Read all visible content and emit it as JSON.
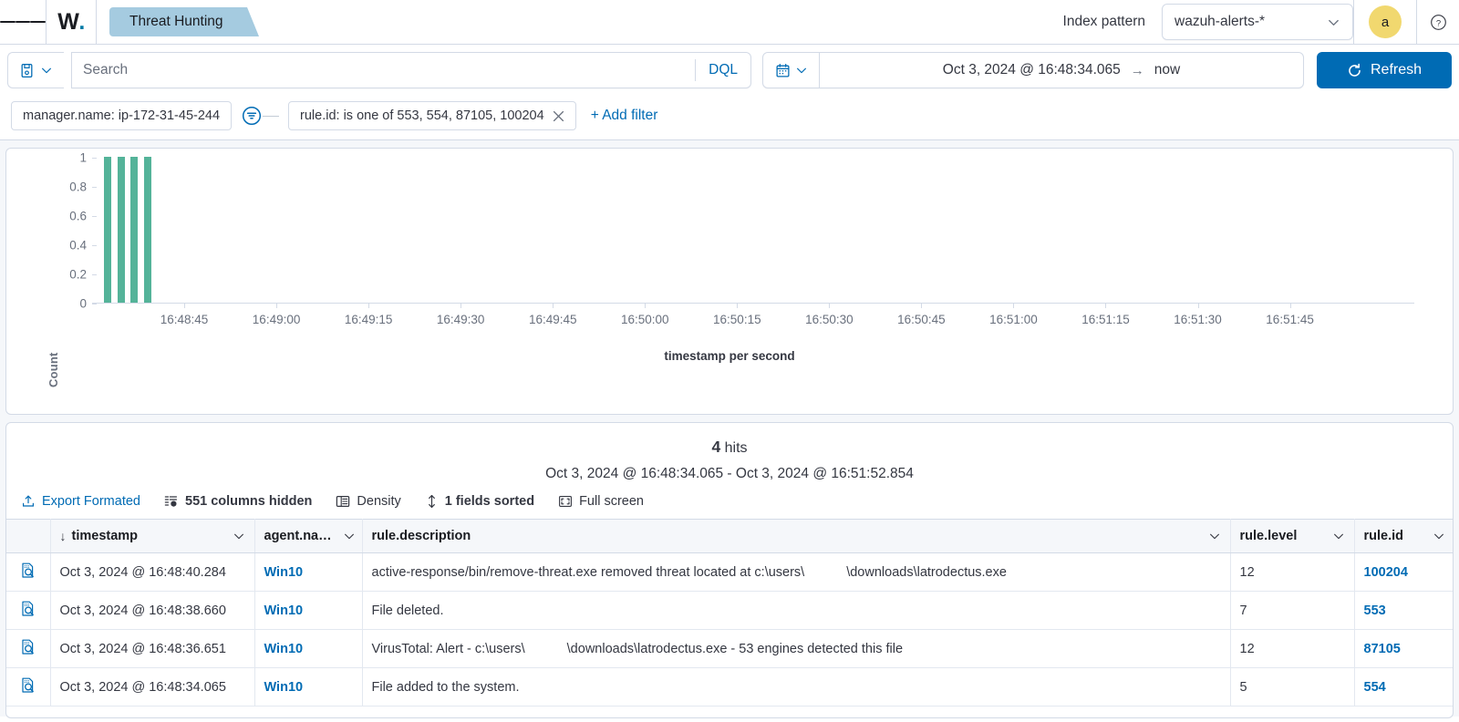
{
  "header": {
    "logo_text": "W",
    "app_tab": "Threat Hunting",
    "index_pattern_label": "Index pattern",
    "index_pattern_value": "wazuh-alerts-*",
    "avatar_initial": "a"
  },
  "query": {
    "search_placeholder": "Search",
    "search_value": "",
    "language": "DQL",
    "date_from": "Oct 3, 2024 @ 16:48:34.065",
    "date_arrow": "→",
    "date_to": "now",
    "refresh_label": "Refresh"
  },
  "filters": {
    "pill1": "manager.name: ip-172-31-45-244",
    "pill2": "rule.id: is one of 553, 554, 87105, 100204",
    "add_filter": "+ Add filter"
  },
  "chart_data": {
    "type": "bar",
    "title": "",
    "xlabel": "timestamp per second",
    "ylabel": "Count",
    "ylim": [
      0,
      1
    ],
    "yticks": [
      "0",
      "0.2",
      "0.4",
      "0.6",
      "0.8",
      "1"
    ],
    "ytick_values": [
      0,
      0.2,
      0.4,
      0.6,
      0.8,
      1
    ],
    "xticks": [
      "16:48:45",
      "16:49:00",
      "16:49:15",
      "16:49:30",
      "16:49:45",
      "16:50:00",
      "16:50:15",
      "16:50:30",
      "16:50:45",
      "16:51:00",
      "16:51:15",
      "16:51:30",
      "16:51:45"
    ],
    "categories": [
      "16:48:34",
      "16:48:36",
      "16:48:38",
      "16:48:40"
    ],
    "values": [
      1,
      1,
      1,
      1
    ],
    "bar_color": "#54b399",
    "grid": false,
    "legend": "none",
    "bar_x_fractions": [
      0.0092,
      0.0192,
      0.0292,
      0.0392
    ]
  },
  "results": {
    "hits_count": "4",
    "hits_label": "hits",
    "range": "Oct 3, 2024 @ 16:48:34.065 - Oct 3, 2024 @ 16:51:52.854",
    "toolbar": {
      "export": "Export Formated",
      "columns_hidden": "551 columns hidden",
      "density": "Density",
      "fields_sorted": "1 fields sorted",
      "full_screen": "Full screen"
    },
    "columns": [
      "timestamp",
      "agent.na…",
      "rule.description",
      "rule.level",
      "rule.id"
    ],
    "rows": [
      {
        "timestamp": "Oct 3, 2024 @ 16:48:40.284",
        "agent": "Win10",
        "desc_a": "active-response/bin/remove-threat.exe removed threat located at c:\\users\\",
        "desc_b": "\\downloads\\latrodectus.exe",
        "level": "12",
        "rule_id": "100204"
      },
      {
        "timestamp": "Oct 3, 2024 @ 16:48:38.660",
        "agent": "Win10",
        "desc_a": "File deleted.",
        "desc_b": "",
        "level": "7",
        "rule_id": "553"
      },
      {
        "timestamp": "Oct 3, 2024 @ 16:48:36.651",
        "agent": "Win10",
        "desc_a": "VirusTotal: Alert - c:\\users\\",
        "desc_b": "\\downloads\\latrodectus.exe - 53 engines detected this file",
        "level": "12",
        "rule_id": "87105"
      },
      {
        "timestamp": "Oct 3, 2024 @ 16:48:34.065",
        "agent": "Win10",
        "desc_a": "File added to the system.",
        "desc_b": "",
        "level": "5",
        "rule_id": "554"
      }
    ]
  },
  "colors": {
    "accent": "#006bb4",
    "bar": "#54b399",
    "tab": "#a5cbe0",
    "avatar": "#f1d86f"
  }
}
